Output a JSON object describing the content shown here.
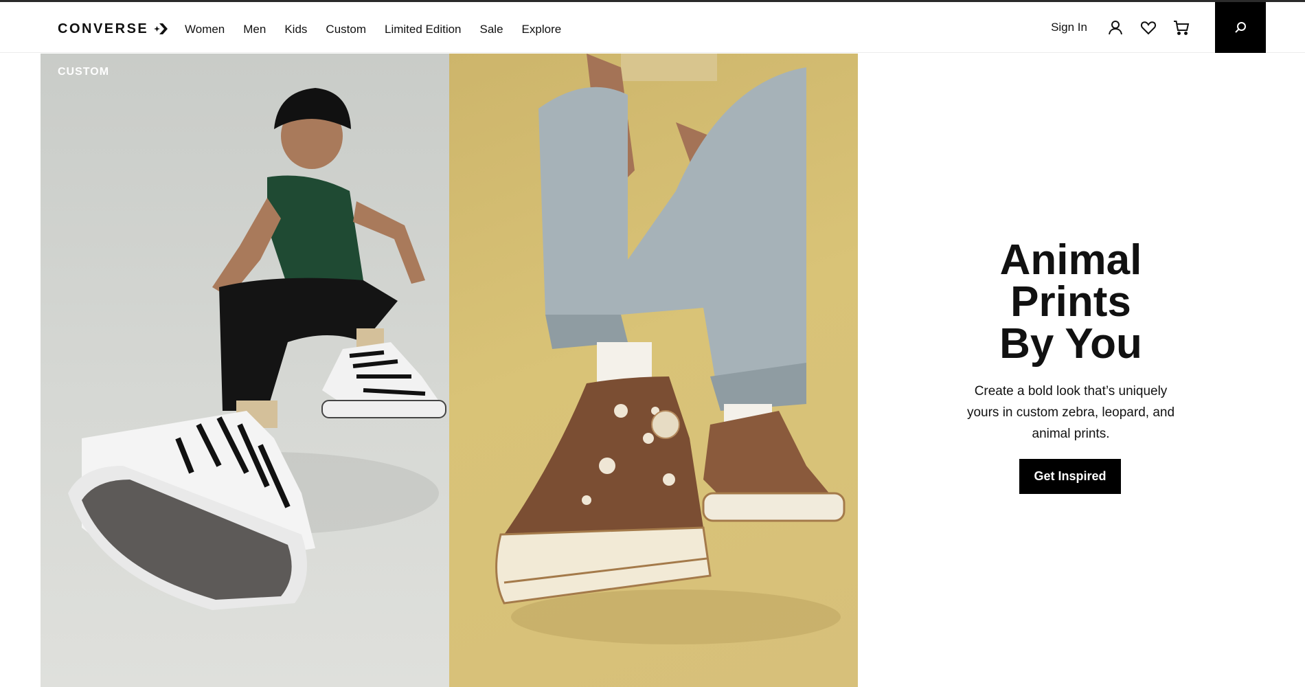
{
  "brand": {
    "logo_text": "CONVERSE",
    "logo_icon": "converse-star-chevron-icon"
  },
  "nav": {
    "items": [
      "Women",
      "Men",
      "Kids",
      "Custom",
      "Limited Edition",
      "Sale",
      "Explore"
    ],
    "sign_in": "Sign In",
    "icons": [
      "account-icon",
      "heart-icon",
      "cart-icon",
      "search-icon"
    ]
  },
  "hero": {
    "eyebrow": "CUSTOM",
    "images": [
      {
        "name": "model-in-zebra-print-sneakers",
        "background": "#d0d2ce"
      },
      {
        "name": "model-in-brown-polka-dot-sneakers",
        "background": "#d5bd72"
      }
    ]
  },
  "promo": {
    "title_lines": [
      "Animal",
      "Prints",
      "By You"
    ],
    "description": "Create a bold look that’s uniquely yours in custom zebra, leopard, and animal prints.",
    "cta_label": "Get Inspired"
  },
  "colors": {
    "text": "#111111",
    "cta_background": "#000000",
    "cta_text": "#ffffff"
  }
}
